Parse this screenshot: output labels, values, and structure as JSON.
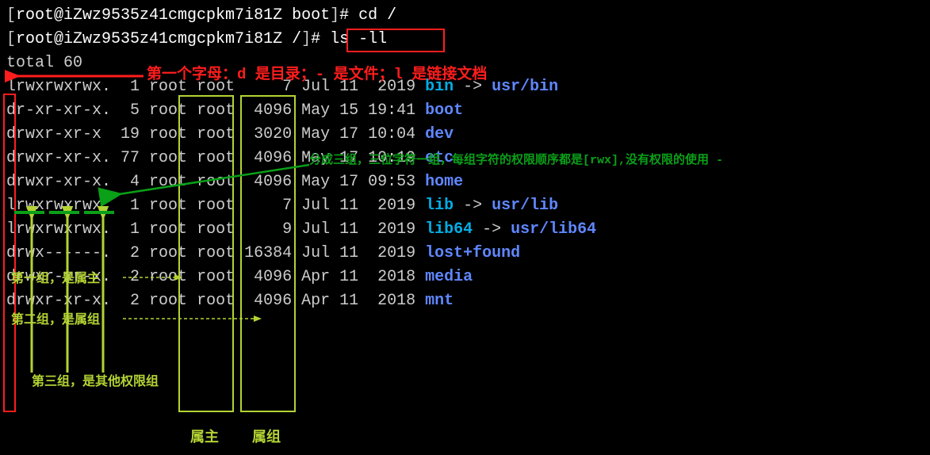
{
  "prompt1": {
    "open": "[",
    "user": "root@iZwz9535z41cmgcpkm7i81Z",
    "path": " boot",
    "close": "]",
    "hash": "# ",
    "cmd": "cd /"
  },
  "prompt2": {
    "open": "[",
    "user": "root@iZwz9535z41cmgcpkm7i81Z",
    "path": " /",
    "close": "]",
    "hash": "# ",
    "cmd": "ls -ll"
  },
  "total": "total 60",
  "rows": [
    {
      "perm": "lrwxrwxrwx.",
      "link": "  1",
      "owner": " root",
      "group": " root",
      "size": "     7",
      "date": " Jul 11  2019 ",
      "name": "bin",
      "arrow": " -> ",
      "target": "usr/bin"
    },
    {
      "perm": "dr-xr-xr-x.",
      "link": "  5",
      "owner": " root",
      "group": " root",
      "size": "  4096",
      "date": " May 15 19:41 ",
      "name": "boot",
      "arrow": "",
      "target": ""
    },
    {
      "perm": "drwxr-xr-x ",
      "link": " 19",
      "owner": " root",
      "group": " root",
      "size": "  3020",
      "date": " May 17 10:04 ",
      "name": "dev",
      "arrow": "",
      "target": ""
    },
    {
      "perm": "drwxr-xr-x.",
      "link": " 77",
      "owner": " root",
      "group": " root",
      "size": "  4096",
      "date": " May 17 10:19 ",
      "name": "etc",
      "arrow": "",
      "target": ""
    },
    {
      "perm": "drwxr-xr-x.",
      "link": "  4",
      "owner": " root",
      "group": " root",
      "size": "  4096",
      "date": " May 17 09:53 ",
      "name": "home",
      "arrow": "",
      "target": ""
    },
    {
      "perm": "lrwxrwxrwx.",
      "link": "  1",
      "owner": " root",
      "group": " root",
      "size": "     7",
      "date": " Jul 11  2019 ",
      "name": "lib",
      "arrow": " -> ",
      "target": "usr/lib"
    },
    {
      "perm": "lrwxrwxrwx.",
      "link": "  1",
      "owner": " root",
      "group": " root",
      "size": "     9",
      "date": " Jul 11  2019 ",
      "name": "lib64",
      "arrow": " -> ",
      "target": "usr/lib64"
    },
    {
      "perm": "drwx------.",
      "link": "  2",
      "owner": " root",
      "group": " root",
      "size": " 16384",
      "date": " Jul 11  2019 ",
      "name": "lost+found",
      "arrow": "",
      "target": ""
    },
    {
      "perm": "drwxr-xr-x.",
      "link": "  2",
      "owner": " root",
      "group": " root",
      "size": "  4096",
      "date": " Apr 11  2018 ",
      "name": "media",
      "arrow": "",
      "target": ""
    },
    {
      "perm": "drwxr-xr-x.",
      "link": "  2",
      "owner": " root",
      "group": " root",
      "size": "  4096",
      "date": " Apr 11  2018 ",
      "name": "mnt",
      "arrow": "",
      "target": ""
    }
  ],
  "annotations": {
    "red_note": "第一个字母：d 是目录；- 是文件；l 是链接文档",
    "green_note": "分成三组，三位字符一组，每组字符的权限顺序都是[rwx],没有权限的使用 -",
    "yg_group1": "第一组，是属主",
    "yg_group2": "第二组，是属组",
    "yg_group3": "第三组，是其他权限组",
    "yg_owner": "属主",
    "yg_group": "属组"
  }
}
